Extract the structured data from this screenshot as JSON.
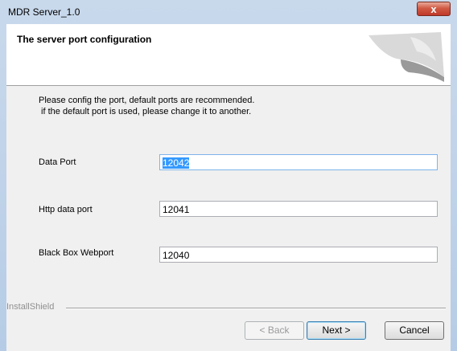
{
  "window": {
    "title": "MDR Server_1.0",
    "close_glyph": "x"
  },
  "header": {
    "title": "The server port configuration",
    "art_icon": "installer-swoosh-graphic"
  },
  "description": {
    "line1": "Please config the port, default ports are recommended.",
    "line2": " if the default port is used, please change it to another."
  },
  "fields": [
    {
      "label": "Data Port",
      "value": "12042",
      "selected": true
    },
    {
      "label": "Http data port",
      "value": "12041",
      "selected": false
    },
    {
      "label": "Black Box Webport",
      "value": "12040",
      "selected": false
    }
  ],
  "footer": {
    "brand": "InstallShield",
    "back_label": "< Back",
    "next_label": "Next >",
    "cancel_label": "Cancel"
  },
  "colors": {
    "accent": "#3399ff",
    "close_button": "#c0382a",
    "title_bar": "#c9d9ec"
  }
}
